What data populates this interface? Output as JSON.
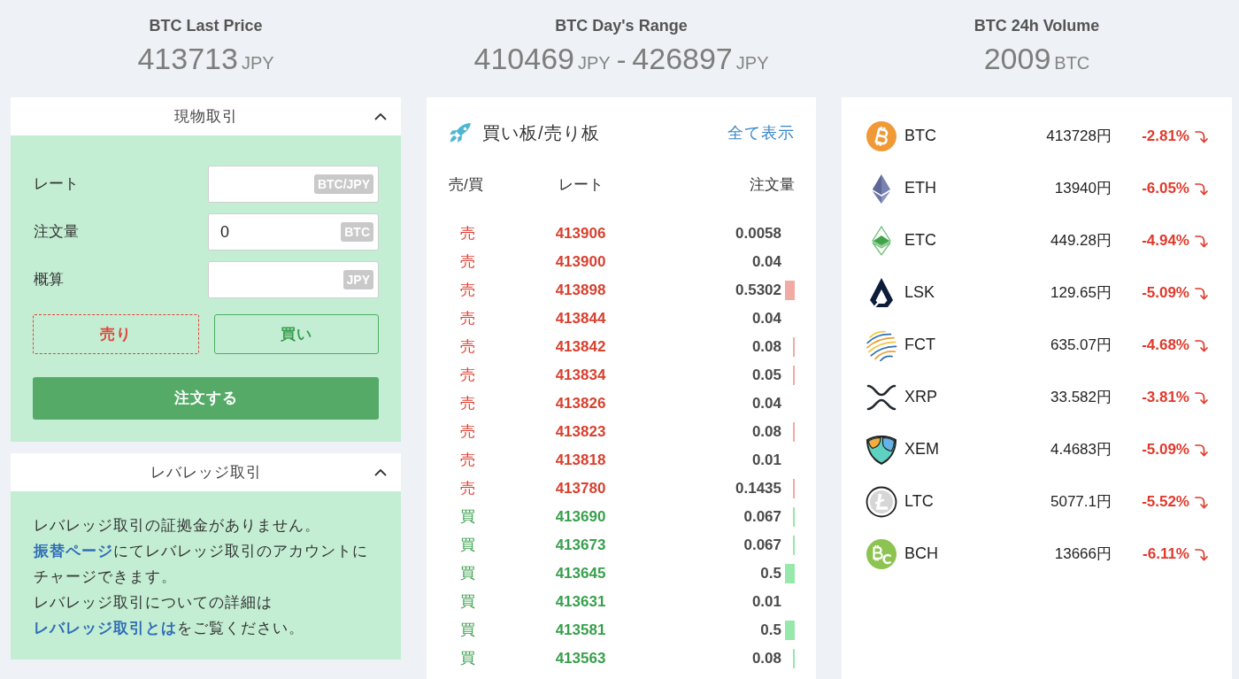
{
  "stats": [
    {
      "title": "BTC Last Price",
      "values": [
        {
          "number": "413713",
          "unit": "JPY"
        }
      ]
    },
    {
      "title": "BTC Day's Range",
      "values": [
        {
          "number": "410469",
          "unit": "JPY"
        },
        {
          "number": "426897",
          "unit": "JPY"
        }
      ],
      "separator": "-"
    },
    {
      "title": "BTC 24h Volume",
      "values": [
        {
          "number": "2009",
          "unit": "BTC"
        }
      ]
    }
  ],
  "spot_panel": {
    "title": "現物取引",
    "expanded": true,
    "fields": [
      {
        "label": "レート",
        "unit": "BTC/JPY"
      },
      {
        "label": "注文量",
        "value": "0",
        "unit": "BTC"
      },
      {
        "label": "概算",
        "unit": "JPY"
      }
    ],
    "side_buttons": [
      {
        "label": "売り",
        "kind": "sell"
      },
      {
        "label": "買い",
        "kind": "buy"
      }
    ],
    "submit_button": "注文する"
  },
  "leverage_panel": {
    "title": "レバレッジ取引",
    "expanded": true,
    "lines": [
      [
        {
          "kind": "text",
          "text": "レバレッジ取引の証拠金がありません。"
        }
      ],
      [
        {
          "kind": "link",
          "text": "振替ページ"
        },
        {
          "kind": "text",
          "text": "にてレバレッジ取引のアカウントに"
        }
      ],
      [
        {
          "kind": "text",
          "text": "チャージできます。"
        }
      ],
      [
        {
          "kind": "text",
          "text": "レバレッジ取引についての詳細は"
        }
      ],
      [
        {
          "kind": "link",
          "text": "レバレッジ取引とは"
        },
        {
          "kind": "text",
          "text": "をご覧ください。"
        }
      ]
    ]
  },
  "order_book": {
    "title": "買い板/売り板",
    "show_all_link": "全て表示",
    "columns": [
      "売/買",
      "レート",
      "注文量"
    ],
    "rows": [
      {
        "kind": "sell",
        "side": "売",
        "rate": "413906",
        "amount": "0.0058",
        "bar": false
      },
      {
        "kind": "sell",
        "side": "売",
        "rate": "413900",
        "amount": "0.04",
        "bar": false
      },
      {
        "kind": "sell",
        "side": "売",
        "rate": "413898",
        "amount": "0.5302",
        "bar": true,
        "bar_wide": true
      },
      {
        "kind": "sell",
        "side": "売",
        "rate": "413844",
        "amount": "0.04",
        "bar": false
      },
      {
        "kind": "sell",
        "side": "売",
        "rate": "413842",
        "amount": "0.08",
        "bar": true,
        "bar_wide": false
      },
      {
        "kind": "sell",
        "side": "売",
        "rate": "413834",
        "amount": "0.05",
        "bar": true,
        "bar_wide": false
      },
      {
        "kind": "sell",
        "side": "売",
        "rate": "413826",
        "amount": "0.04",
        "bar": false
      },
      {
        "kind": "sell",
        "side": "売",
        "rate": "413823",
        "amount": "0.08",
        "bar": true,
        "bar_wide": false
      },
      {
        "kind": "sell",
        "side": "売",
        "rate": "413818",
        "amount": "0.01",
        "bar": false
      },
      {
        "kind": "sell",
        "side": "売",
        "rate": "413780",
        "amount": "0.1435",
        "bar": true,
        "bar_wide": false
      },
      {
        "kind": "buy",
        "side": "買",
        "rate": "413690",
        "amount": "0.067",
        "bar": true,
        "bar_wide": false
      },
      {
        "kind": "buy",
        "side": "買",
        "rate": "413673",
        "amount": "0.067",
        "bar": true,
        "bar_wide": false
      },
      {
        "kind": "buy",
        "side": "買",
        "rate": "413645",
        "amount": "0.5",
        "bar": true,
        "bar_wide": true
      },
      {
        "kind": "buy",
        "side": "買",
        "rate": "413631",
        "amount": "0.01",
        "bar": false
      },
      {
        "kind": "buy",
        "side": "買",
        "rate": "413581",
        "amount": "0.5",
        "bar": true,
        "bar_wide": true
      },
      {
        "kind": "buy",
        "side": "買",
        "rate": "413563",
        "amount": "0.08",
        "bar": true,
        "bar_wide": false
      }
    ]
  },
  "markets": [
    {
      "symbol": "BTC",
      "price": "413728円",
      "change": "-2.81%",
      "falling": true
    },
    {
      "symbol": "ETH",
      "price": "13940円",
      "change": "-6.05%",
      "falling": true
    },
    {
      "symbol": "ETC",
      "price": "449.28円",
      "change": "-4.94%",
      "falling": true
    },
    {
      "symbol": "LSK",
      "price": "129.65円",
      "change": "-5.09%",
      "falling": true
    },
    {
      "symbol": "FCT",
      "price": "635.07円",
      "change": "-4.68%",
      "falling": true
    },
    {
      "symbol": "XRP",
      "price": "33.582円",
      "change": "-3.81%",
      "falling": true
    },
    {
      "symbol": "XEM",
      "price": "4.4683円",
      "change": "-5.09%",
      "falling": true
    },
    {
      "symbol": "LTC",
      "price": "5077.1円",
      "change": "-5.52%",
      "falling": true
    },
    {
      "symbol": "BCH",
      "price": "13666円",
      "change": "-6.11%",
      "falling": true
    }
  ]
}
